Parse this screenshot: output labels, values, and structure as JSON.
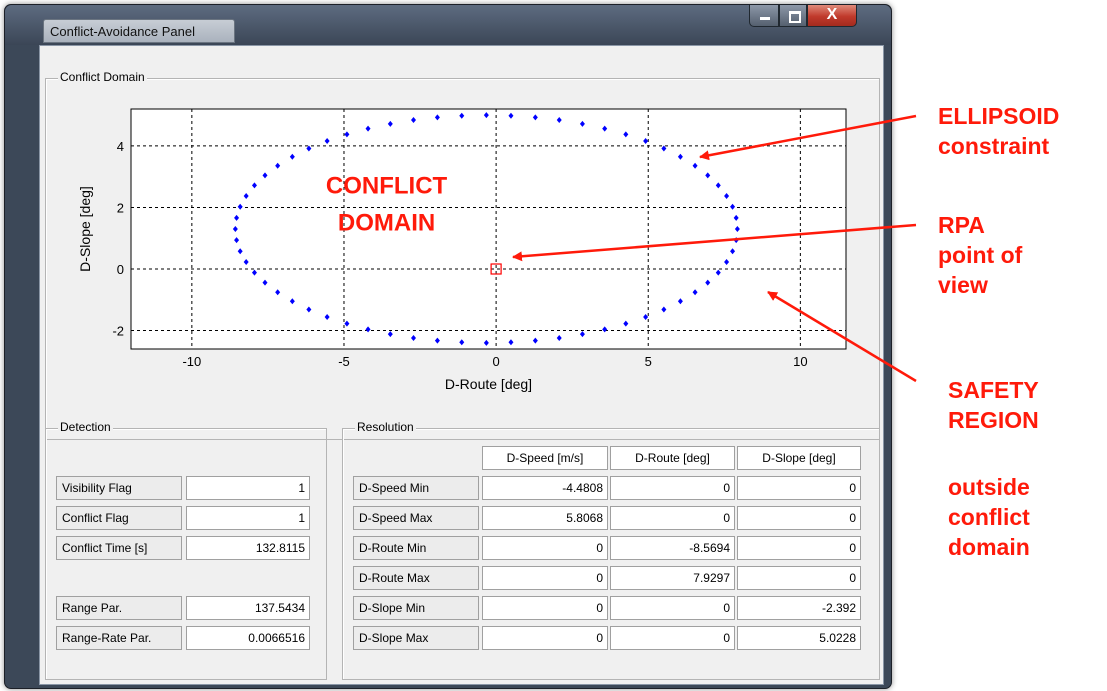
{
  "window": {
    "title": "Conflict-Avoidance Panel",
    "close_glyph": "X"
  },
  "conflict_panel": {
    "group_label": "Conflict Domain",
    "domain_label_line1": "CONFLICT",
    "domain_label_line2": "DOMAIN"
  },
  "chart_data": {
    "type": "scatter",
    "xlabel": "D-Route [deg]",
    "ylabel": "D-Slope [deg]",
    "xlim": [
      -12,
      11.5
    ],
    "ylim": [
      -2.6,
      5.2
    ],
    "xticks": [
      -10,
      -5,
      0,
      5,
      10
    ],
    "yticks": [
      -2,
      0,
      2,
      4
    ],
    "grid": true,
    "grid_style": "dashed",
    "series": [
      {
        "marker": "diamond",
        "color": "#0000ff",
        "ellipse_center": [
          -0.32,
          1.3
        ],
        "ellipse_semi_axes": [
          8.25,
          3.7
        ],
        "points": 64
      }
    ],
    "rpa_point": {
      "x": 0,
      "y": 0,
      "marker": "square",
      "color": "#ff0000"
    }
  },
  "detection": {
    "group_label": "Detection",
    "rows": [
      {
        "label": "Visibility Flag",
        "value": "1"
      },
      {
        "label": "Conflict Flag",
        "value": "1"
      },
      {
        "label": "Conflict Time [s]",
        "value": "132.8115"
      },
      {
        "label": "Range Par.",
        "value": "137.5434"
      },
      {
        "label": "Range-Rate Par.",
        "value": "0.0066516"
      }
    ]
  },
  "resolution": {
    "group_label": "Resolution",
    "columns": [
      "D-Speed  [m/s]",
      "D-Route  [deg]",
      "D-Slope  [deg]"
    ],
    "rows": [
      {
        "label": "D-Speed  Min",
        "values": [
          "-4.4808",
          "0",
          "0"
        ]
      },
      {
        "label": "D-Speed  Max",
        "values": [
          "5.8068",
          "0",
          "0"
        ]
      },
      {
        "label": "D-Route  Min",
        "values": [
          "0",
          "-8.5694",
          "0"
        ]
      },
      {
        "label": "D-Route  Max",
        "values": [
          "0",
          "7.9297",
          "0"
        ]
      },
      {
        "label": "D-Slope  Min",
        "values": [
          "0",
          "0",
          "-2.392"
        ]
      },
      {
        "label": "D-Slope  Max",
        "values": [
          "0",
          "0",
          "5.0228"
        ]
      }
    ]
  },
  "annotations": {
    "ellipsoid_line1": "ELLIPSOID",
    "ellipsoid_line2": "constraint",
    "rpa_line1": "RPA",
    "rpa_line2": "point of",
    "rpa_line3": "view",
    "safety_line1": "SAFETY",
    "safety_line2": "REGION",
    "outside_line1": "outside",
    "outside_line2": "conflict",
    "outside_line3": "domain",
    "color": "#ff1a0a"
  }
}
